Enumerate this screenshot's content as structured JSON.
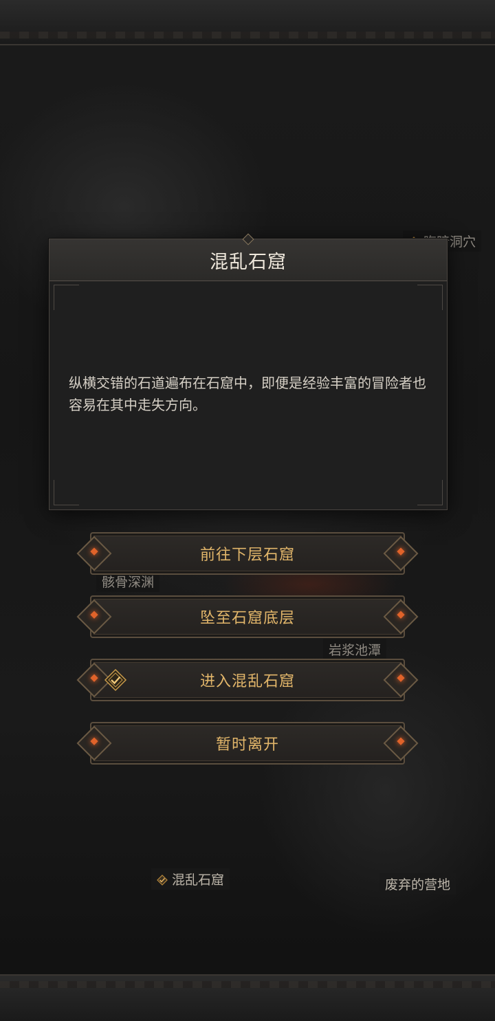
{
  "map": {
    "labels": {
      "dark_cave": "晦暗洞穴",
      "bone_abyss": "骸骨深渊",
      "lava_pool": "岩浆池潭",
      "chaos_cave": "混乱石窟",
      "abandoned_camp": "废弃的营地"
    },
    "visited_icon": "checkmark-badge-icon"
  },
  "dialog": {
    "title": "混乱石窟",
    "description": "纵横交错的石道遍布在石窟中，即便是经验丰富的冒险者也容易在其中走失方向。"
  },
  "options": [
    {
      "label": "前往下层石窟"
    },
    {
      "label": "坠至石窟底层"
    },
    {
      "label": "进入混乱石窟",
      "checked": true
    },
    {
      "label": "暂时离开"
    }
  ],
  "colors": {
    "option_text": "#e2b66a",
    "gem_accent": "#e0632a",
    "dialog_bg": "#1f1f1f"
  }
}
